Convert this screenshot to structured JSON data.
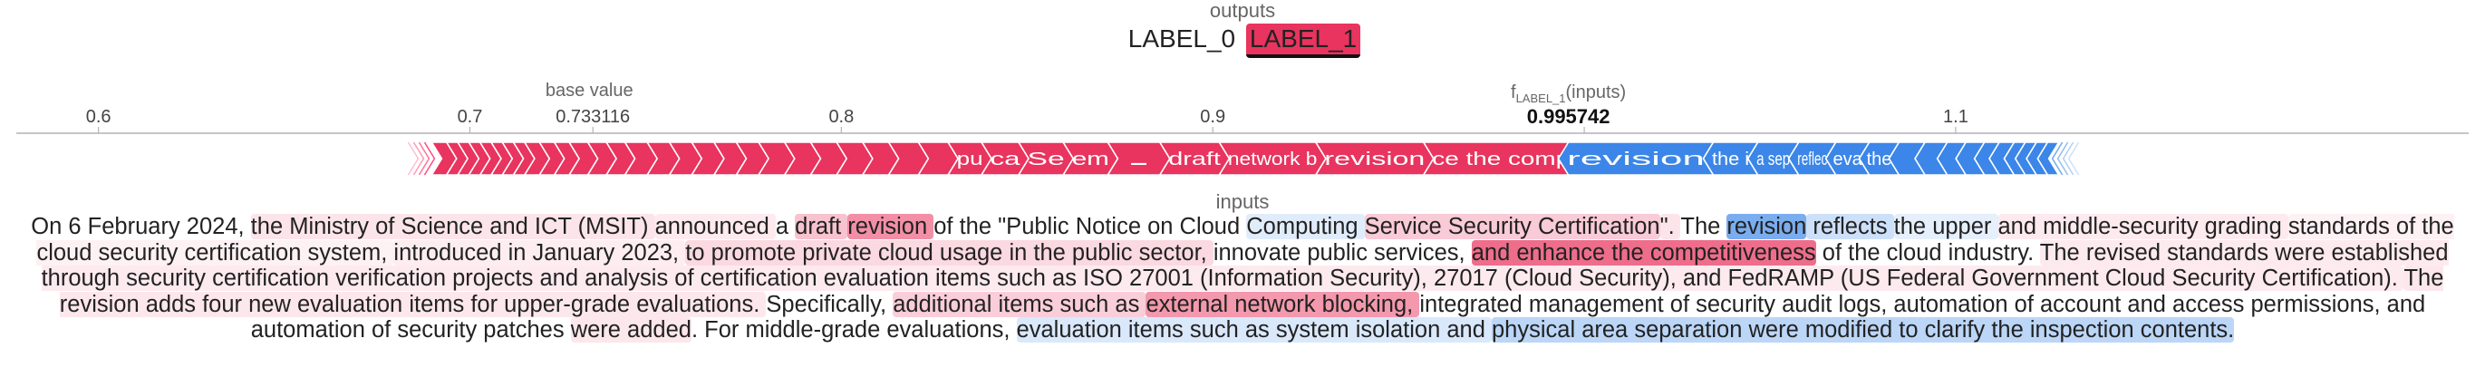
{
  "header": {
    "outputs_title": "outputs",
    "labels": [
      {
        "text": "LABEL_0",
        "active": false
      },
      {
        "text": "LABEL_1",
        "active": true
      }
    ]
  },
  "chart_data": {
    "type": "force",
    "base_value_label": "base value",
    "base_value": 0.733116,
    "base_value_text": "0.733116",
    "output_name_main": "f",
    "output_name_sub": "LABEL_1",
    "output_name_suffix": "(inputs)",
    "output_value": 0.995742,
    "output_value_text": "0.995742",
    "xlim": [
      0.5735,
      1.2425
    ],
    "ticks": [
      0.6,
      0.7,
      0.8,
      0.9,
      1.0,
      1.1
    ],
    "tick_labels": [
      "0.6",
      "0.7",
      "",
      "0.8",
      "0.9",
      "",
      "1.1"
    ],
    "colors": {
      "positive": "#ff0051",
      "positive_bar": "#e8345e",
      "negative": "#3b86e8",
      "axis": "#b3b3b3"
    },
    "positive_segments": [
      {
        "label": "",
        "value": 0.004
      },
      {
        "label": "",
        "value": 0.003
      },
      {
        "label": "",
        "value": 0.003
      },
      {
        "label": "",
        "value": 0.003
      },
      {
        "label": "",
        "value": 0.003
      },
      {
        "label": "",
        "value": 0.003
      },
      {
        "label": "",
        "value": 0.003
      },
      {
        "label": "",
        "value": 0.003
      },
      {
        "label": "",
        "value": 0.004
      },
      {
        "label": "",
        "value": 0.004
      },
      {
        "label": "",
        "value": 0.004
      },
      {
        "label": "",
        "value": 0.005
      },
      {
        "label": "",
        "value": 0.005
      },
      {
        "label": "",
        "value": 0.005
      },
      {
        "label": "",
        "value": 0.006
      },
      {
        "label": "",
        "value": 0.006
      },
      {
        "label": "",
        "value": 0.006
      },
      {
        "label": "",
        "value": 0.006
      },
      {
        "label": "",
        "value": 0.006
      },
      {
        "label": "",
        "value": 0.006
      },
      {
        "label": "",
        "value": 0.007
      },
      {
        "label": "",
        "value": 0.007
      },
      {
        "label": "",
        "value": 0.007
      },
      {
        "label": "",
        "value": 0.007
      },
      {
        "label": "",
        "value": 0.007
      },
      {
        "label": "",
        "value": 0.008
      },
      {
        "label": "",
        "value": 0.008
      },
      {
        "label": "pu",
        "value": 0.009
      },
      {
        "label": "ca",
        "value": 0.01
      },
      {
        "label": "Se",
        "value": 0.012
      },
      {
        "label": "em",
        "value": 0.012
      },
      {
        "label": ".",
        "value": 0.014
      },
      {
        "label": "draft",
        "value": 0.016
      },
      {
        "label": "network b",
        "value": 0.026
      },
      {
        "label": "revision",
        "value": 0.029
      },
      {
        "label": "ce the comp",
        "value": 0.039
      }
    ],
    "negative_segments": [
      {
        "label": "revision",
        "value": 0.039
      },
      {
        "label": "the i",
        "value": 0.012
      },
      {
        "label": "a sep",
        "value": 0.011
      },
      {
        "label": "reflec",
        "value": 0.01
      },
      {
        "label": "eva",
        "value": 0.009
      },
      {
        "label": "the",
        "value": 0.008
      },
      {
        "label": "",
        "value": 0.007
      },
      {
        "label": "",
        "value": 0.006
      },
      {
        "label": "",
        "value": 0.005
      },
      {
        "label": "",
        "value": 0.005
      },
      {
        "label": "",
        "value": 0.004
      },
      {
        "label": "",
        "value": 0.004
      },
      {
        "label": "",
        "value": 0.003
      },
      {
        "label": "",
        "value": 0.003
      },
      {
        "label": "",
        "value": 0.003
      },
      {
        "label": "",
        "value": 0.003
      }
    ]
  },
  "inputs": {
    "title": "inputs",
    "tokens": [
      {
        "text": "On 6 February 2024, ",
        "w": 0
      },
      {
        "text": "the Ministry of Science and ICT (MSIT) ",
        "w": 0.15
      },
      {
        "text": "announced ",
        "w": 0.12
      },
      {
        "text": "a ",
        "w": 0
      },
      {
        "text": "draft ",
        "w": 0.35
      },
      {
        "text": "revision ",
        "w": 0.65
      },
      {
        "text": "of the \"Public Notice on Cloud ",
        "w": 0
      },
      {
        "text": "Computing ",
        "w": -0.18
      },
      {
        "text": "Service Security Certification",
        "w": 0.3
      },
      {
        "text": "\". ",
        "w": 0.15
      },
      {
        "text": "The ",
        "w": 0
      },
      {
        "text": "revision",
        "w": -0.8
      },
      {
        "text": " reflects ",
        "w": -0.3
      },
      {
        "text": "the upper ",
        "w": -0.15
      },
      {
        "text": "and middle-security grading ",
        "w": 0.12
      },
      {
        "text": "standards of the cloud security certification system, ",
        "w": 0.08
      },
      {
        "text": "introduced in January 2023, ",
        "w": 0.1
      },
      {
        "text": "to promote private cloud usage in the public sector, ",
        "w": 0.22
      },
      {
        "text": "innovate public services, ",
        "w": 0
      },
      {
        "text": "and enhance the competitiveness",
        "w": 0.85
      },
      {
        "text": " of the cloud industry. ",
        "w": 0
      },
      {
        "text": "The revised standards were established through security certification verification projects and analysis of certification evaluation items such as ISO 27001 (Information Security), 27017 (Cloud Security), and FedRAMP (US Federal Government Cloud Security Certification). ",
        "w": 0.12
      },
      {
        "text": "The revision adds four new evaluation items for upper-grade evaluations. ",
        "w": 0.14
      },
      {
        "text": "Specifically, ",
        "w": 0
      },
      {
        "text": "additional items such as ",
        "w": 0.28
      },
      {
        "text": "external network blocking, ",
        "w": 0.6
      },
      {
        "text": "integrated management of security audit logs, automation of account and access permissions, and automation of security patches ",
        "w": 0
      },
      {
        "text": "were added",
        "w": 0.14
      },
      {
        "text": ". For middle-grade evaluations, ",
        "w": 0
      },
      {
        "text": "evaluation items such as system isolation and ",
        "w": -0.22
      },
      {
        "text": "physical area separation were modified to clarify the inspection contents.",
        "w": -0.4
      }
    ]
  }
}
